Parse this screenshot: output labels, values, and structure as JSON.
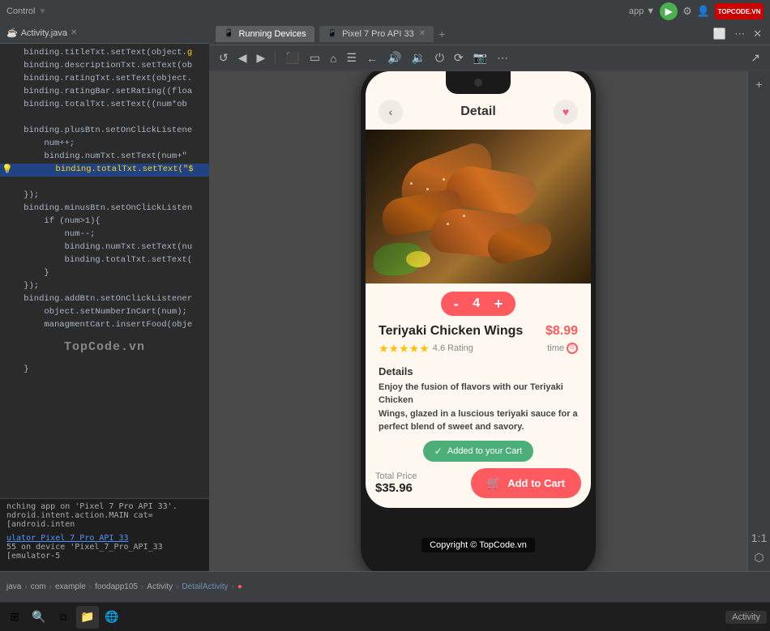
{
  "topbar": {
    "title": "Control",
    "logo_text": "TOPCODE.VN"
  },
  "tabs": {
    "running_devices": "Running Devices",
    "pixel_tab": "Pixel 7 Pro API 33"
  },
  "code_tab": {
    "filename": "Activity.java"
  },
  "code_lines": [
    {
      "num": "",
      "text": "binding.titleTxt.setText(object.g",
      "classes": "c-white"
    },
    {
      "num": "",
      "text": "binding.descriptionTxt.setText(ob",
      "classes": "c-white"
    },
    {
      "num": "",
      "text": "binding.ratingTxt.setText(object.",
      "classes": "c-white"
    },
    {
      "num": "",
      "text": "binding.ratingBar.setRating((floa",
      "classes": "c-white"
    },
    {
      "num": "",
      "text": "binding.totalTxt.setText((num*ob",
      "classes": "c-white"
    },
    {
      "num": "",
      "text": "",
      "classes": ""
    },
    {
      "num": "",
      "text": "binding.plusBtn.setOnClickListene",
      "classes": "c-white"
    },
    {
      "num": "",
      "text": "    num++;",
      "classes": "c-white"
    },
    {
      "num": "",
      "text": "    binding.numTxt.setText(num+\"\"",
      "classes": "c-white"
    },
    {
      "num": "",
      "text": "    binding.totalTxt.setText(\"$\"",
      "classes": "c-yellow c-highlight"
    },
    {
      "num": "",
      "text": "",
      "classes": ""
    },
    {
      "num": "",
      "text": "});",
      "classes": "c-white"
    },
    {
      "num": "",
      "text": "binding.minusBtn.setOnClickListen",
      "classes": "c-white"
    },
    {
      "num": "",
      "text": "    if (num>1){",
      "classes": "c-white"
    },
    {
      "num": "",
      "text": "        num--;",
      "classes": "c-white"
    },
    {
      "num": "",
      "text": "        binding.numTxt.setText(nu",
      "classes": "c-white"
    },
    {
      "num": "",
      "text": "        binding.totalTxt.setText(",
      "classes": "c-white"
    },
    {
      "num": "",
      "text": "    }",
      "classes": "c-white"
    },
    {
      "num": "",
      "text": "});",
      "classes": "c-white"
    },
    {
      "num": "",
      "text": "binding.addBtn.setOnClickListener",
      "classes": "c-white"
    },
    {
      "num": "",
      "text": "    object.setNumberInCart(num);",
      "classes": "c-white"
    },
    {
      "num": "",
      "text": "    managmentCart.insertFood(obje",
      "classes": "c-white"
    },
    {
      "num": "",
      "text": "}",
      "classes": "c-white"
    }
  ],
  "watermark": "TopCode.vn",
  "console_lines": [
    "nching app on 'Pixel 7 Pro API 33'.",
    "ndroid.intent.action.MAIN cat=[android.inten",
    "",
    "ulator Pixel 7 Pro API 33",
    "55 on device 'Pixel_7_Pro_API_33 [emulator-5"
  ],
  "app": {
    "header_title": "Detail",
    "product_name": "Teriyaki Chicken Wings",
    "price": "$8.99",
    "rating_value": "4.6 Rating",
    "time_label": "time",
    "quantity": "4",
    "details_title": "Details",
    "details_text": "Enjoy the fusion of flavors with our Teriyaki Chicken\nWings, glazed in a luscious teriyaki sauce for a\nperfect blend of sweet and savory.",
    "total_label": "Total Price",
    "total_amount": "$35.96",
    "cart_notification": "Added to your Cart",
    "add_to_cart_btn": "Add to Cart",
    "qty_minus": "-",
    "qty_plus": "+"
  },
  "breadcrumb": {
    "items": [
      "java",
      "com",
      "example",
      "foodapp105",
      "Activity",
      "DetailActivity",
      "●"
    ]
  },
  "copyright": "Copyright © TopCode.vn",
  "taskbar": {
    "activity_label": "Activity"
  }
}
